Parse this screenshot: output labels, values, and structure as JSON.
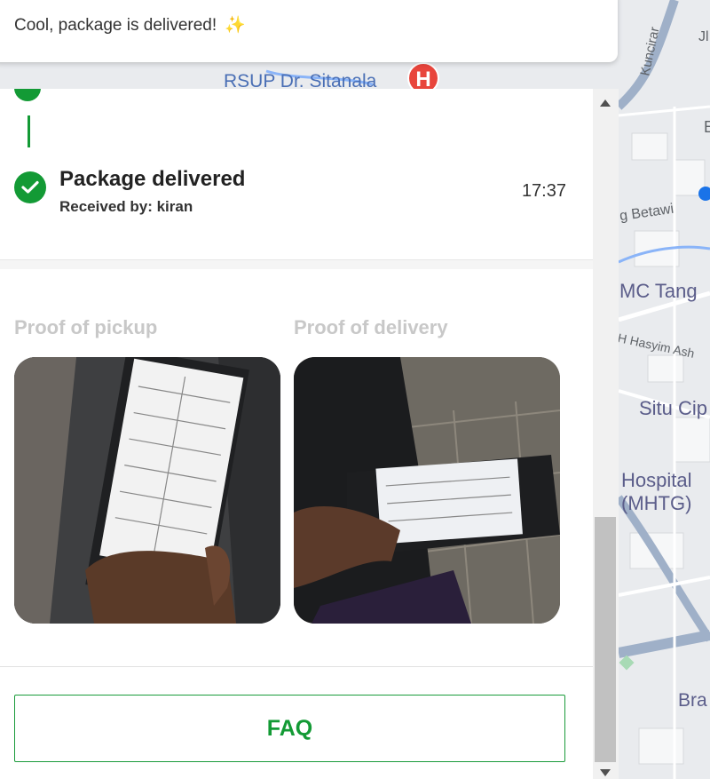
{
  "toast": {
    "message": "Cool, package is delivered!",
    "emoji": "✨"
  },
  "map": {
    "labels": {
      "kuncir": "Kuncirar",
      "ji": "Jl",
      "e": "E",
      "betawi": "g Betawi",
      "mc": "MC Tang",
      "hasyim": "H Hasyim Ash",
      "situ": "Situ Cip",
      "hospital_line1": "Hospital",
      "hospital_line2": "(MHTG)",
      "bra": "Bra",
      "rsup": "RSUP Dr. Sitanala"
    },
    "hospital_marker": "H"
  },
  "status": {
    "title": "Package delivered",
    "received_by": "Received by: kiran",
    "time": "17:37",
    "color": "#139a35"
  },
  "proofs": {
    "pickup_label": "Proof of pickup",
    "delivery_label": "Proof of delivery"
  },
  "faq": {
    "label": "FAQ"
  }
}
